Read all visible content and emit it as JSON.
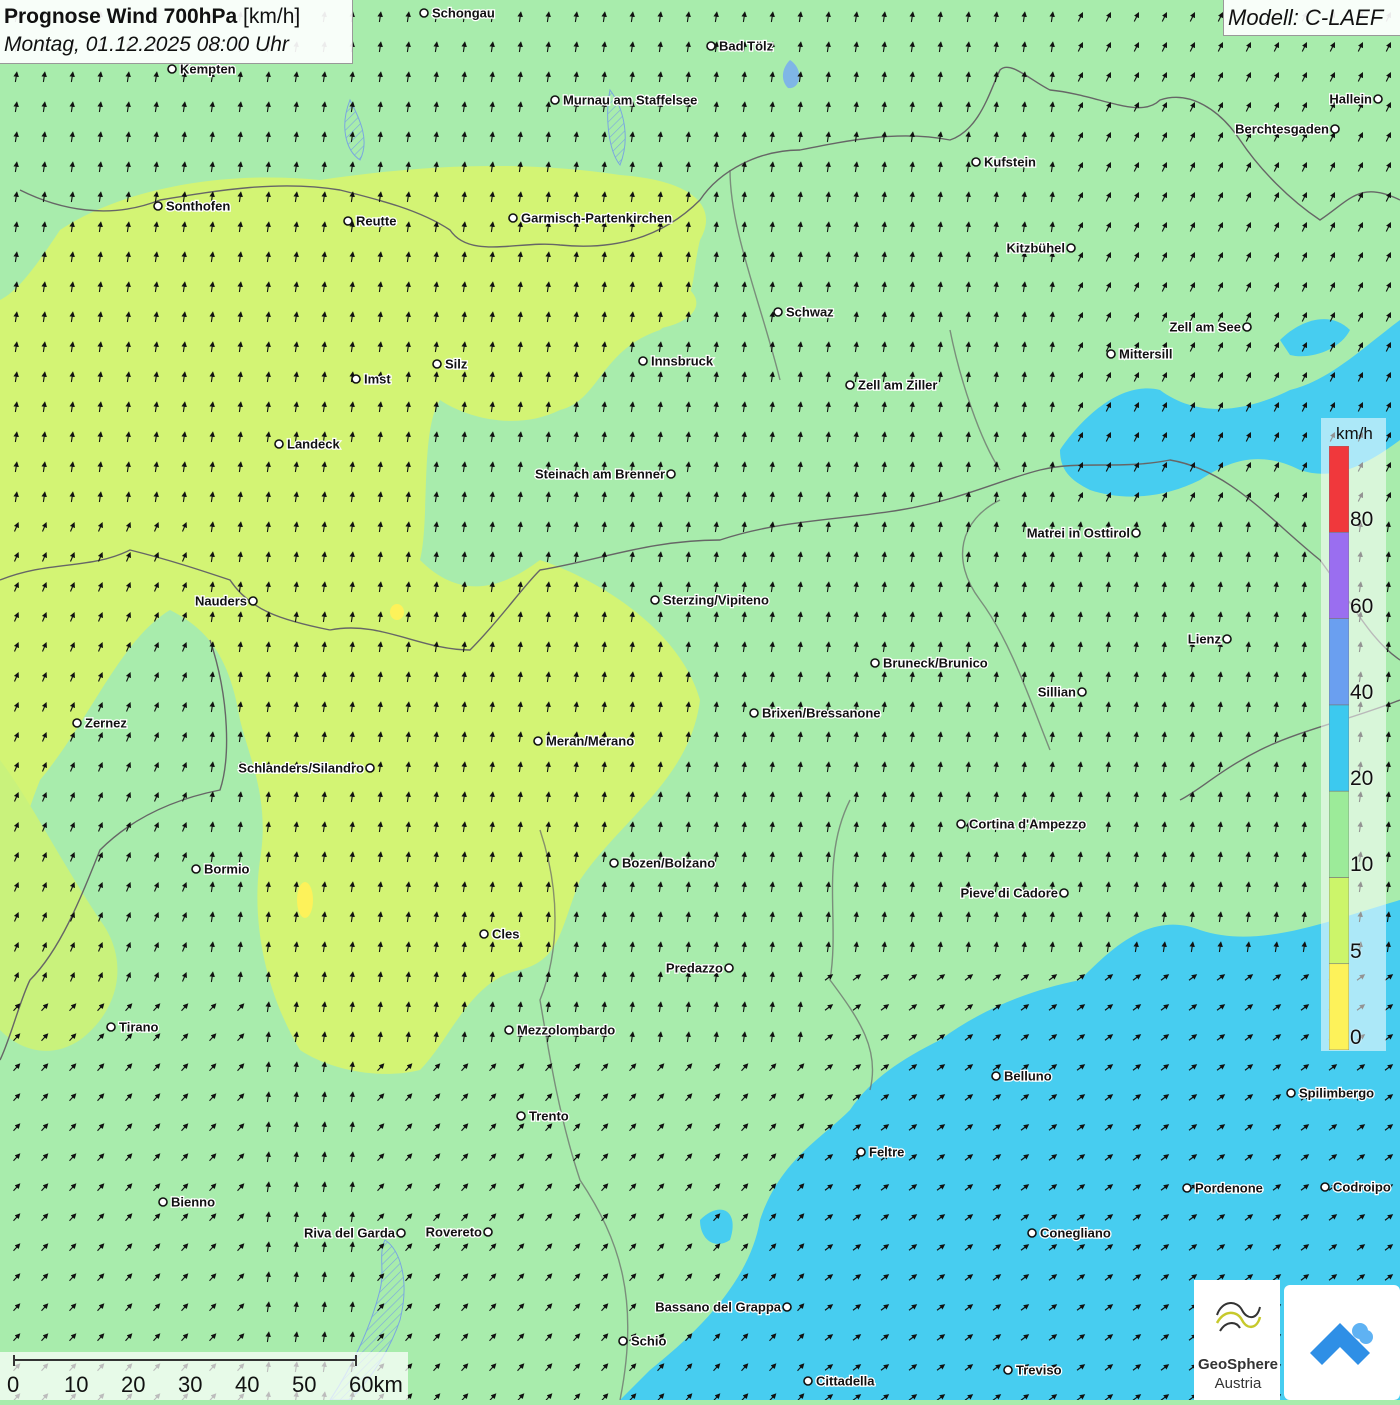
{
  "header": {
    "title_bold": "Prognose Wind 700hPa",
    "title_unit": "[km/h]",
    "subtitle": "Montag, 01.12.2025 08:00 Uhr"
  },
  "model": {
    "label": "Modell: C-LAEF"
  },
  "legend": {
    "unit": "km/h",
    "ticks": [
      "0",
      "5",
      "10",
      "20",
      "40",
      "60",
      "80"
    ],
    "colors": [
      "#fdf25a",
      "#ccf56a",
      "#9ceb99",
      "#3cc9ef",
      "#6a9ff0",
      "#9a6ef0",
      "#f0383c"
    ]
  },
  "scale": {
    "labels": [
      "0",
      "10",
      "20",
      "30",
      "40",
      "50",
      "60km"
    ]
  },
  "logos": {
    "geosphere_name": "GeoSphere",
    "geosphere_sub": "Austria",
    "geosphere_icon": "geosphere-logo-icon",
    "app_icon": "app-logo-icon"
  },
  "places": [
    {
      "name": "Schongau",
      "side": "right"
    },
    {
      "name": "Bad Tölz",
      "side": "right"
    },
    {
      "name": "Kempten",
      "side": "right"
    },
    {
      "name": "Murnau am Staffelsee",
      "side": "right"
    },
    {
      "name": "Hallein",
      "side": "left"
    },
    {
      "name": "Berchtesgaden",
      "side": "left"
    },
    {
      "name": "Kufstein",
      "side": "right"
    },
    {
      "name": "Sonthofen",
      "side": "right"
    },
    {
      "name": "Reutte",
      "side": "right"
    },
    {
      "name": "Garmisch-Partenkirchen",
      "side": "right"
    },
    {
      "name": "Kitzbühel",
      "side": "left"
    },
    {
      "name": "Schwaz",
      "side": "right"
    },
    {
      "name": "Zell am See",
      "side": "left"
    },
    {
      "name": "Mittersill",
      "side": "right"
    },
    {
      "name": "Innsbruck",
      "side": "right"
    },
    {
      "name": "Silz",
      "side": "right"
    },
    {
      "name": "Imst",
      "side": "right"
    },
    {
      "name": "Zell am Ziller",
      "side": "right"
    },
    {
      "name": "Landeck",
      "side": "right"
    },
    {
      "name": "Steinach am Brenner",
      "side": "left"
    },
    {
      "name": "Matrei in Osttirol",
      "side": "left"
    },
    {
      "name": "Nauders",
      "side": "left"
    },
    {
      "name": "Sterzing/Vipiteno",
      "side": "right"
    },
    {
      "name": "Lienz",
      "side": "left"
    },
    {
      "name": "Bruneck/Brunico",
      "side": "right"
    },
    {
      "name": "Sillian",
      "side": "left"
    },
    {
      "name": "Brixen/Bressanone",
      "side": "right"
    },
    {
      "name": "Zernez",
      "side": "right"
    },
    {
      "name": "Meran/Merano",
      "side": "right"
    },
    {
      "name": "Schlanders/Silandro",
      "side": "left"
    },
    {
      "name": "Cortina d'Ampezzo",
      "side": "right"
    },
    {
      "name": "Bozen/Bolzano",
      "side": "right"
    },
    {
      "name": "Bormio",
      "side": "right"
    },
    {
      "name": "Pieve di Cadore",
      "side": "left"
    },
    {
      "name": "Cles",
      "side": "right"
    },
    {
      "name": "Predazzo",
      "side": "left"
    },
    {
      "name": "Tirano",
      "side": "right"
    },
    {
      "name": "Mezzolombardo",
      "side": "right"
    },
    {
      "name": "Belluno",
      "side": "right"
    },
    {
      "name": "Spilimbergo",
      "side": "right"
    },
    {
      "name": "Trento",
      "side": "right"
    },
    {
      "name": "Feltre",
      "side": "right"
    },
    {
      "name": "Pordenone",
      "side": "right"
    },
    {
      "name": "Codroipo",
      "side": "right"
    },
    {
      "name": "Bienno",
      "side": "right"
    },
    {
      "name": "Riva del Garda",
      "side": "left"
    },
    {
      "name": "Rovereto",
      "side": "left"
    },
    {
      "name": "Conegliano",
      "side": "right"
    },
    {
      "name": "Bassano del Grappa",
      "side": "left"
    },
    {
      "name": "Schio",
      "side": "right"
    },
    {
      "name": "Treviso",
      "side": "right"
    },
    {
      "name": "Cittadella",
      "side": "right"
    }
  ]
}
